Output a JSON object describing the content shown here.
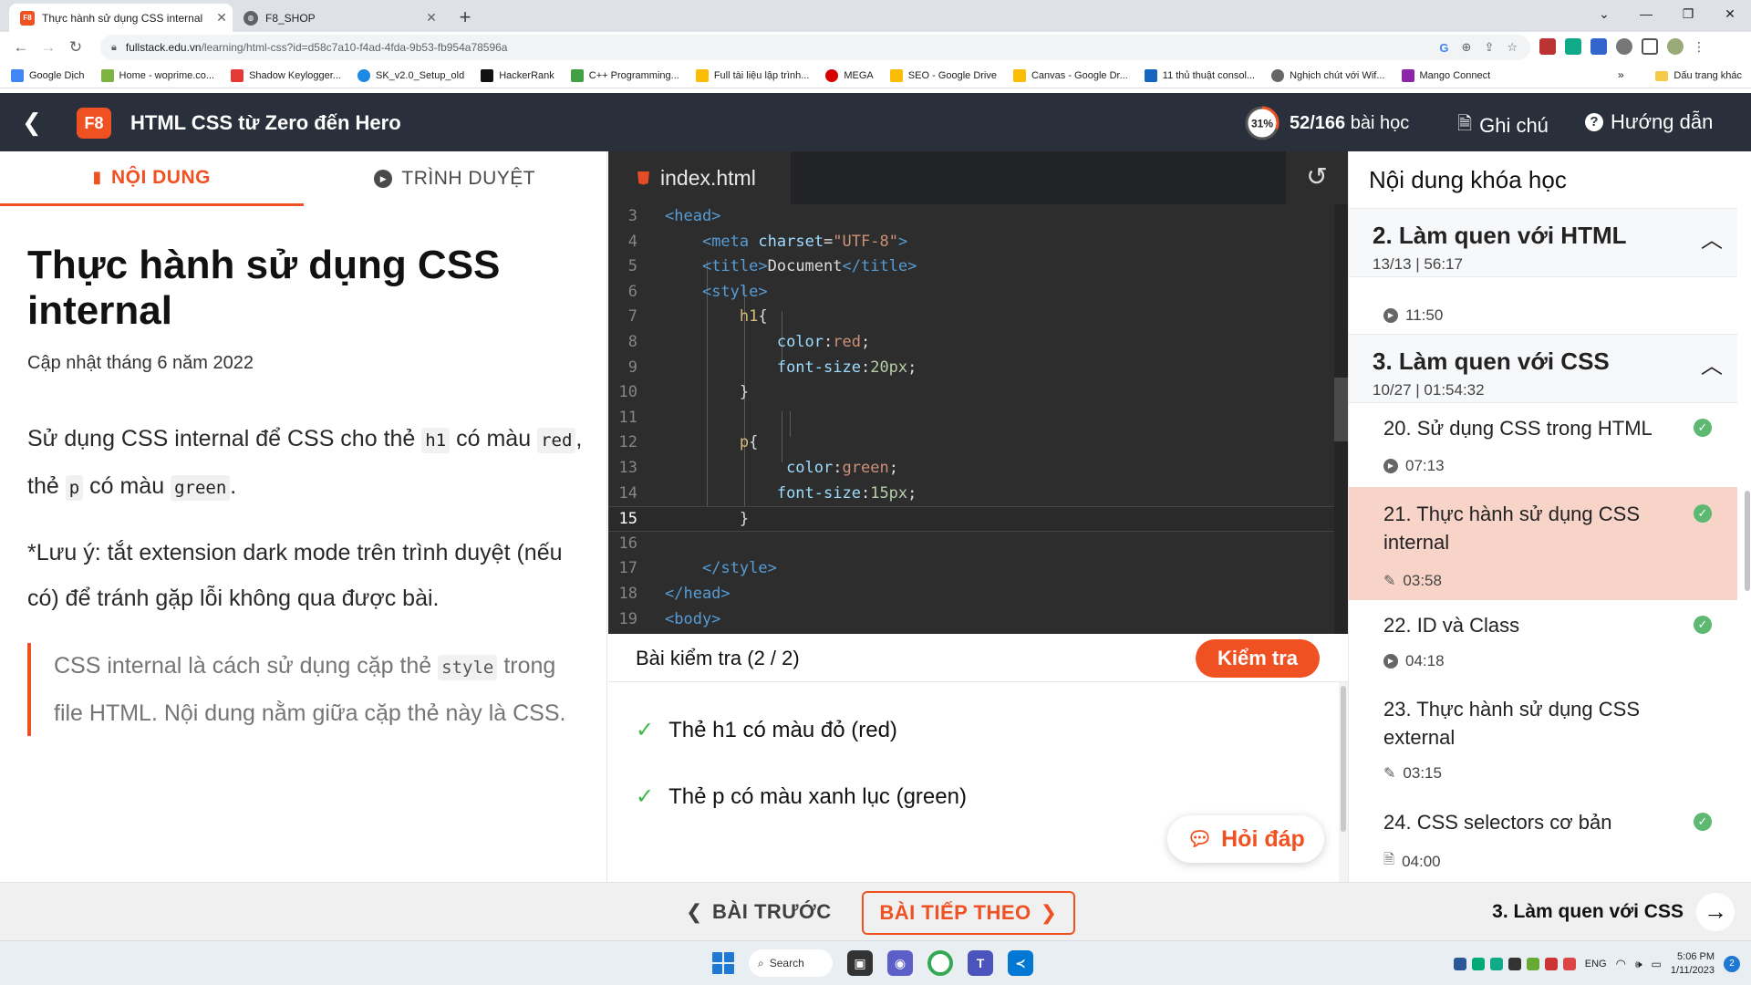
{
  "browser": {
    "tabs": [
      {
        "title": "Thực hành sử dụng CSS internal",
        "favicon": "F8",
        "active": true
      },
      {
        "title": "F8_SHOP",
        "favicon": "globe-icon",
        "active": false
      }
    ],
    "url_host": "fullstack.edu.vn",
    "url_path": "/learning/html-css?id=d58c7a10-f4ad-4fda-9b53-fb954a78596a",
    "bookmarks": [
      "Google Dịch",
      "Home - woprime.co...",
      "Shadow Keylogger...",
      "SK_v2.0_Setup_old",
      "HackerRank",
      "C++ Programming...",
      "Full tài liệu lập trình...",
      "MEGA",
      "SEO - Google Drive",
      "Canvas - Google Dr...",
      "11 thủ thuật consol...",
      "Nghịch chút với Wif...",
      "Mango Connect"
    ],
    "bookmarks_more": "»",
    "bookmarks_folder": "Dấu trang khác"
  },
  "header": {
    "logo": "F8",
    "course_title": "HTML CSS từ Zero đến Hero",
    "progress_percent": "31%",
    "progress_value": 0.31,
    "lessons_done": "52/166",
    "lessons_word": "bài học",
    "notes": "Ghi chú",
    "help": "Hướng dẫn"
  },
  "left": {
    "tab_content": "NỘI DUNG",
    "tab_browser": "TRÌNH DUYỆT",
    "title": "Thực hành sử dụng CSS internal",
    "updated": "Cập nhật tháng 6 năm 2022",
    "p1_a": "Sử dụng CSS internal để CSS cho thẻ",
    "p1_code1": "h1",
    "p1_b": "có màu",
    "p1_code2": "red",
    "p1_c": ", thẻ",
    "p1_code3": "p",
    "p1_d": "có màu",
    "p1_code4": "green",
    "p1_e": ".",
    "p2": "*Lưu ý: tắt extension dark mode trên trình duyệt (nếu có) để tránh gặp lỗi không qua được bài.",
    "quote_a": "CSS internal là cách sử dụng cặp thẻ",
    "quote_code": "style",
    "quote_b": "trong file HTML. Nội dung nằm giữa cặp thẻ này là CSS."
  },
  "editor": {
    "filename": "index.html",
    "current_line": 15,
    "lines": [
      {
        "n": "3"
      },
      {
        "n": "4"
      },
      {
        "n": "5"
      },
      {
        "n": "6"
      },
      {
        "n": "7"
      },
      {
        "n": "8"
      },
      {
        "n": "9"
      },
      {
        "n": "10"
      },
      {
        "n": "11"
      },
      {
        "n": "12"
      },
      {
        "n": "13"
      },
      {
        "n": "14"
      },
      {
        "n": "15"
      },
      {
        "n": "16"
      },
      {
        "n": "17"
      },
      {
        "n": "18"
      },
      {
        "n": "19"
      }
    ],
    "code": {
      "l3": "<head>",
      "l4_open": "<meta",
      "l4_attr": "charset",
      "l4_eq": "=",
      "l4_val": "\"UTF-8\"",
      "l4_close": ">",
      "l5_open": "<title>",
      "l5_text": "Document",
      "l5_close": "</title>",
      "l6": "<style>",
      "l7_sel": "h1",
      "l7_brace": "{",
      "l8_prop": "color",
      "l8_colon": ":",
      "l8_val": "red",
      "l8_semi": ";",
      "l9_prop": "font-size",
      "l9_colon": ":",
      "l9_val": "20px",
      "l9_semi": ";",
      "l10": "}",
      "l12_sel": "p",
      "l12_brace": "{",
      "l13_prop": "color",
      "l13_colon": ":",
      "l13_val": "green",
      "l13_semi": ";",
      "l14_prop": "font-size",
      "l14_colon": ":",
      "l14_val": "15px",
      "l14_semi": ";",
      "l15": "}",
      "l17": "</style>",
      "l18": "</head>",
      "l19": "<body>"
    }
  },
  "test": {
    "title": "Bài kiểm tra (2 / 2)",
    "check_button": "Kiểm tra",
    "items": [
      "Thẻ h1 có màu đỏ (red)",
      "Thẻ p có màu xanh lục (green)"
    ],
    "help_button": "Hỏi đáp"
  },
  "sidebar": {
    "title": "Nội dung khóa học",
    "sections": [
      {
        "title": "2. Làm quen với HTML",
        "meta": "13/13 | 56:17"
      },
      {
        "title": "3. Làm quen với CSS",
        "meta": "10/27 | 01:54:32"
      }
    ],
    "partial_lesson_time": "11:50",
    "lessons": [
      {
        "title": "20. Sử dụng CSS trong HTML",
        "time": "07:13",
        "type": "video",
        "done": true
      },
      {
        "title": "21. Thực hành sử dụng CSS internal",
        "time": "03:58",
        "type": "exercise",
        "done": true,
        "active": true
      },
      {
        "title": "22. ID và Class",
        "time": "04:18",
        "type": "video",
        "done": true
      },
      {
        "title": "23. Thực hành sử dụng CSS external",
        "time": "03:15",
        "type": "exercise",
        "done": false
      },
      {
        "title": "24. CSS selectors cơ bản",
        "time": "04:00",
        "type": "document",
        "done": true
      }
    ]
  },
  "bottom": {
    "prev": "BÀI TRƯỚC",
    "next": "BÀI TIẾP THEO",
    "section_link": "3. Làm quen với CSS"
  },
  "taskbar": {
    "search": "Search",
    "lang": "ENG",
    "time": "5:06 PM",
    "date": "1/11/2023",
    "notifications": "2"
  },
  "colors": {
    "brand": "#f05123",
    "header_bg": "#29303b",
    "editor_bg": "#2d2d2d",
    "active_lesson_bg": "#f8d3c8",
    "done_green": "#5db872"
  }
}
